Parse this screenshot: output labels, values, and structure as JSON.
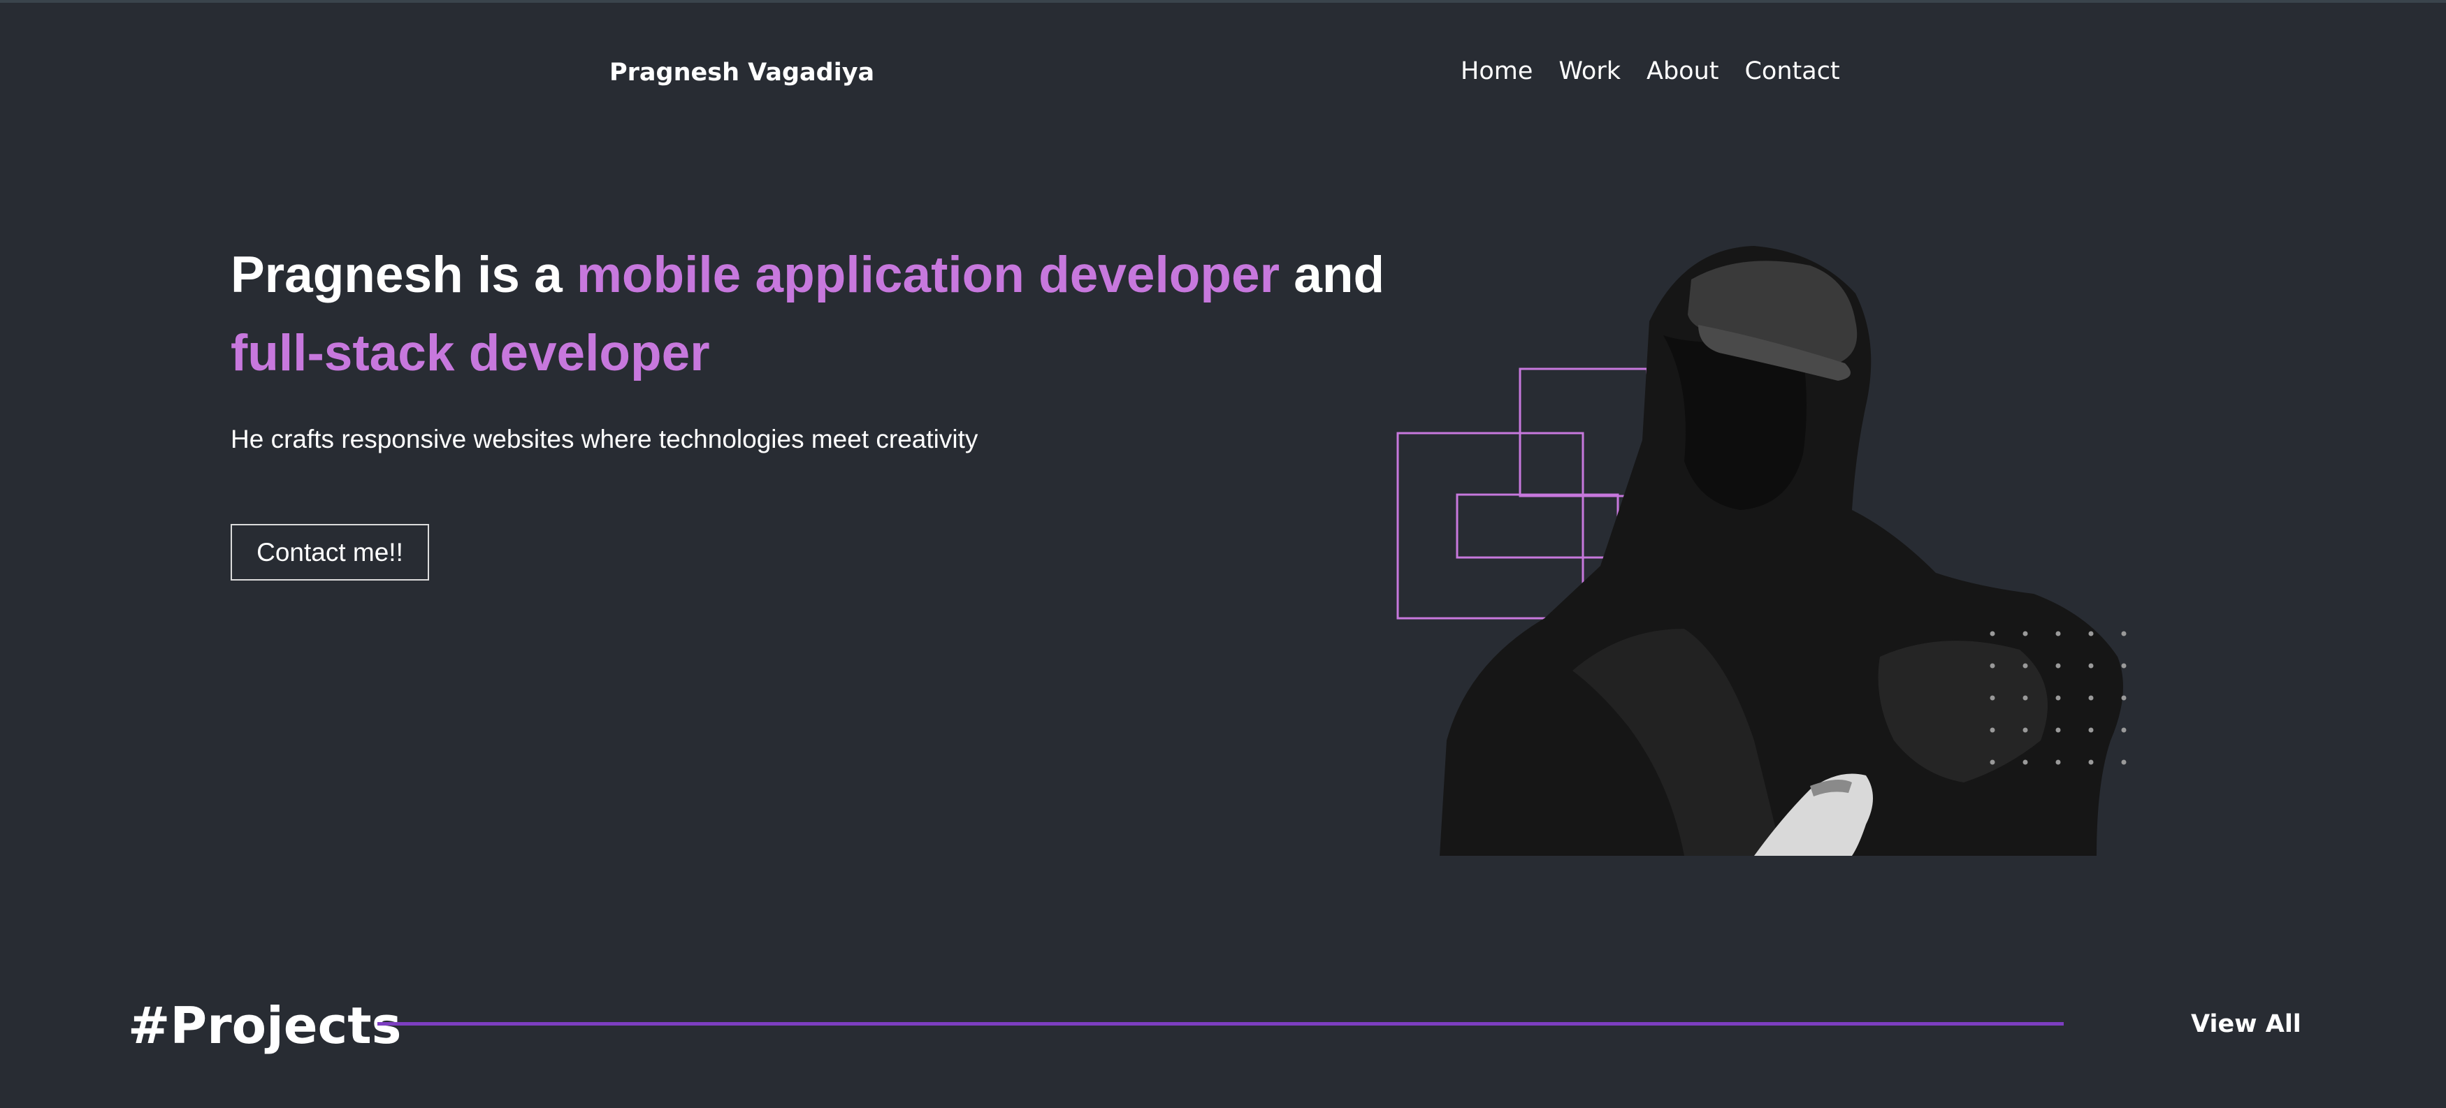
{
  "header": {
    "logo": "Pragnesh Vagadiya",
    "nav": [
      "Home",
      "Work",
      "About",
      "Contact"
    ]
  },
  "hero": {
    "title_part1": "Pragnesh is a ",
    "title_accent1": "mobile application developer",
    "title_part2": " and ",
    "title_accent2": "full-stack developer",
    "subtitle": "He crafts responsive websites where technologies meet creativity",
    "cta_label": "Contact me!!"
  },
  "projects": {
    "heading": "#Projects",
    "view_all": "View All"
  },
  "colors": {
    "background": "#282c33",
    "accent": "#c778dd",
    "divider": "#7d3ec1",
    "text": "#ffffff"
  }
}
